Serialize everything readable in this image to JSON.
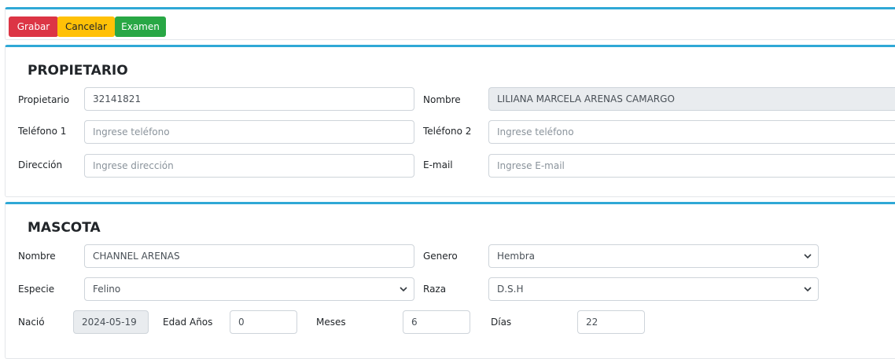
{
  "toolbar": {
    "save_label": "Grabar",
    "cancel_label": "Cancelar",
    "exam_label": "Examen",
    "colors": {
      "save": "#dc3545",
      "cancel": "#ffc107",
      "exam": "#28a745",
      "accent": "#2fa8d6"
    }
  },
  "owner": {
    "title": "PROPIETARIO",
    "owner_label": "Propietario",
    "owner_value": "32141821",
    "name_label": "Nombre",
    "name_value": "LILIANA MARCELA ARENAS CAMARGO",
    "phone1_label": "Teléfono 1",
    "phone1_placeholder": "Ingrese teléfono",
    "phone2_label": "Teléfono 2",
    "phone2_placeholder": "Ingrese teléfono",
    "address_label": "Dirección",
    "address_placeholder": "Ingrese dirección",
    "email_label": "E-mail",
    "email_placeholder": "Ingrese E-mail"
  },
  "pet": {
    "title": "MASCOTA",
    "name_label": "Nombre",
    "name_value": "CHANNEL ARENAS",
    "gender_label": "Genero",
    "gender_value": "Hembra",
    "species_label": "Especie",
    "species_value": "Felino",
    "breed_label": "Raza",
    "breed_value": "D.S.H",
    "born_label": "Nació",
    "born_value": "2024-05-19",
    "age_years_label": "Edad Años",
    "age_years_value": "0",
    "months_label": "Meses",
    "months_value": "6",
    "days_label": "Días",
    "days_value": "22"
  }
}
